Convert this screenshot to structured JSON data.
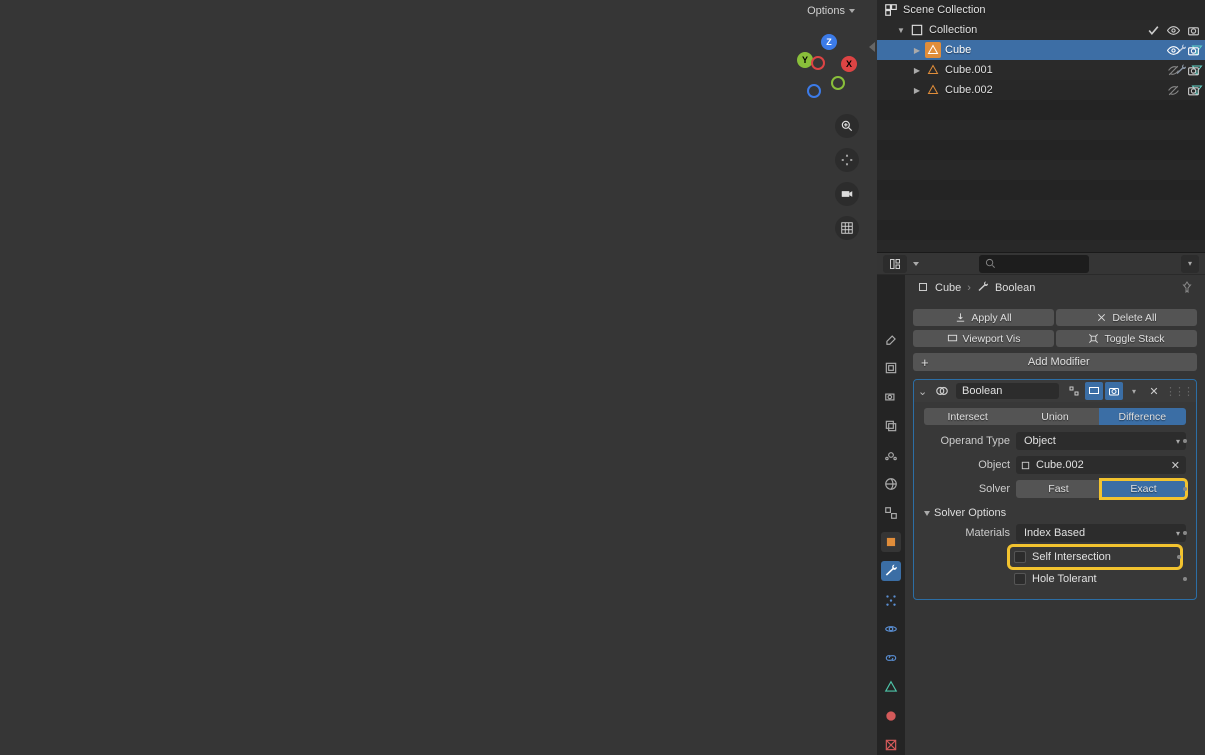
{
  "viewport": {
    "options_label": "Options",
    "axes": {
      "x": "X",
      "y": "Y",
      "z": "Z"
    }
  },
  "outliner": {
    "root": "Scene Collection",
    "collection": "Collection",
    "items": [
      {
        "name": "Cube",
        "selected": true,
        "visible": true
      },
      {
        "name": "Cube.001",
        "selected": false,
        "visible": false
      },
      {
        "name": "Cube.002",
        "selected": false,
        "visible": false
      }
    ]
  },
  "breadcrumb": {
    "object": "Cube",
    "modifier": "Boolean"
  },
  "buttons": {
    "apply_all": "Apply All",
    "delete_all": "Delete All",
    "viewport_vis": "Viewport Vis",
    "toggle_stack": "Toggle Stack",
    "add_modifier": "Add Modifier"
  },
  "modifier": {
    "name": "Boolean",
    "ops": {
      "intersect": "Intersect",
      "union": "Union",
      "difference": "Difference"
    },
    "operand_type_label": "Operand Type",
    "operand_type_value": "Object",
    "object_label": "Object",
    "object_value": "Cube.002",
    "solver_label": "Solver",
    "solver": {
      "fast": "Fast",
      "exact": "Exact"
    },
    "solver_options_label": "Solver Options",
    "materials_label": "Materials",
    "materials_value": "Index Based",
    "self_intersection": "Self Intersection",
    "hole_tolerant": "Hole Tolerant"
  }
}
